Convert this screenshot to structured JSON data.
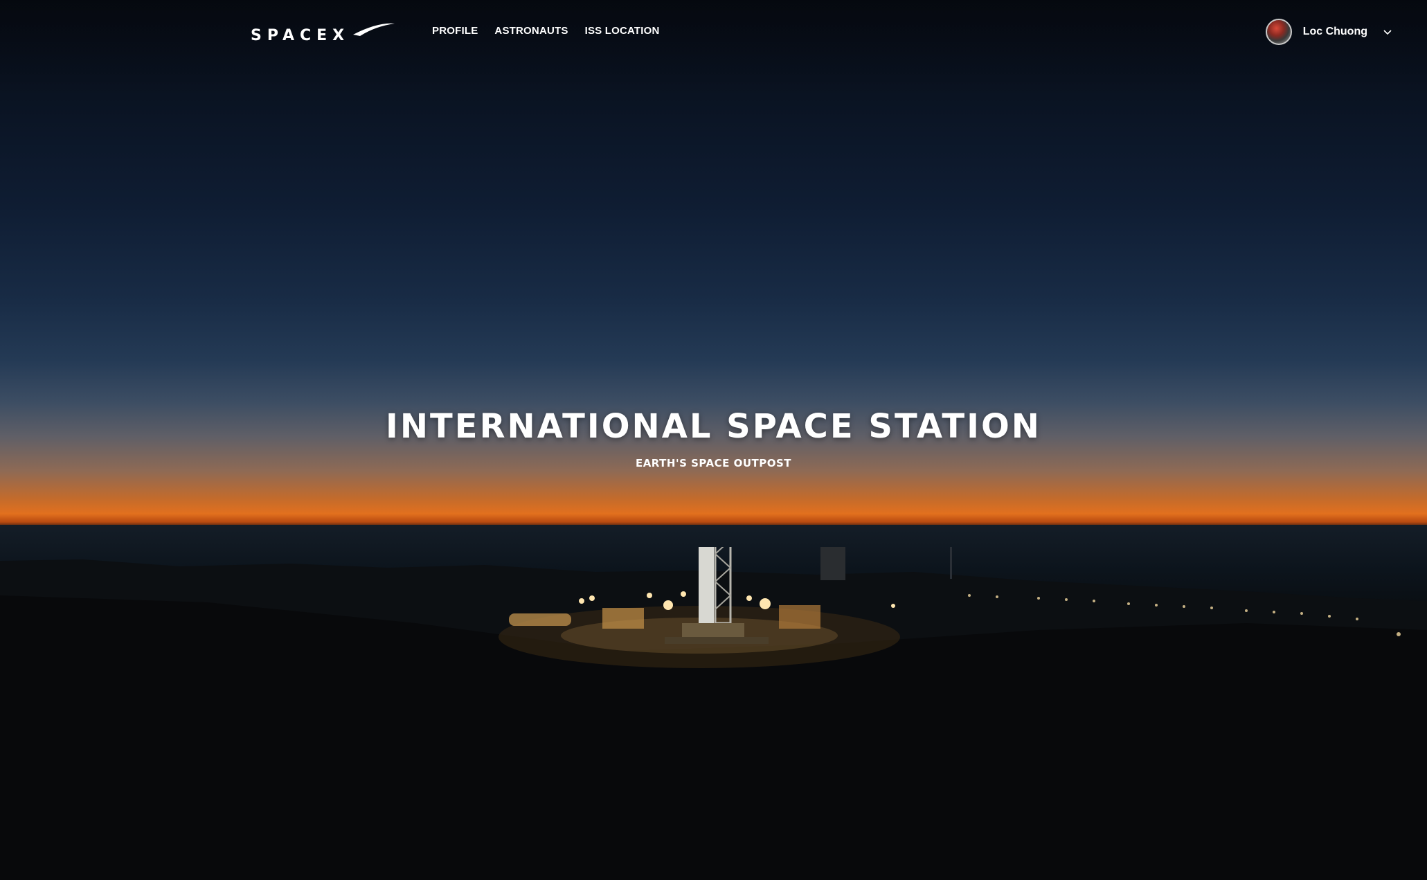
{
  "brand": {
    "logo_text": "SPACEX"
  },
  "nav": {
    "items": [
      {
        "label": "PROFILE"
      },
      {
        "label": "ASTRONAUTS"
      },
      {
        "label": "ISS LOCATION"
      }
    ]
  },
  "user": {
    "name": "Loc Chuong"
  },
  "hero": {
    "title": "INTERNATIONAL SPACE STATION",
    "subtitle": "EARTH'S SPACE OUTPOST"
  },
  "colors": {
    "text": "#ffffff",
    "sky_top": "#080d17",
    "horizon": "#e2701e",
    "ground": "#0a1016"
  },
  "icons": {
    "dropdown": "chevron-down-icon"
  }
}
